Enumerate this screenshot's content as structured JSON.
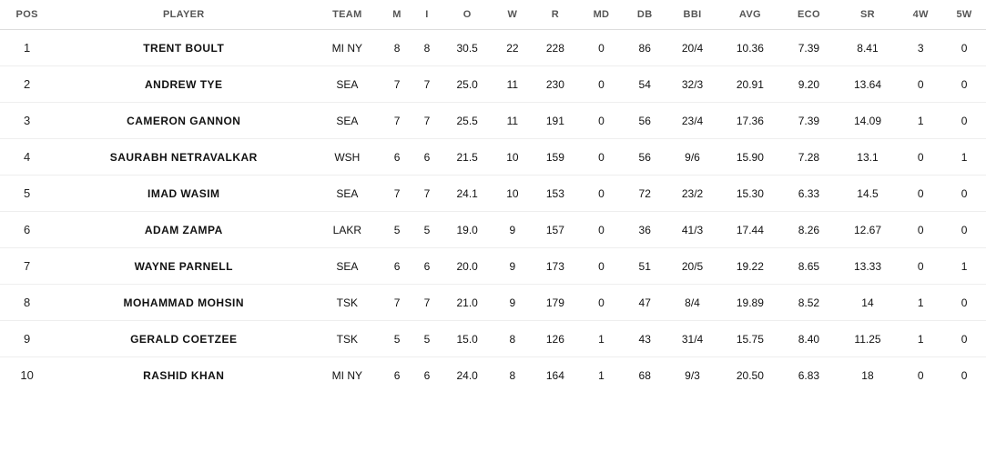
{
  "columns": [
    {
      "key": "pos",
      "label": "POS"
    },
    {
      "key": "player",
      "label": "PLAYER"
    },
    {
      "key": "team",
      "label": "TEAM"
    },
    {
      "key": "m",
      "label": "M"
    },
    {
      "key": "i",
      "label": "I"
    },
    {
      "key": "o",
      "label": "O"
    },
    {
      "key": "w",
      "label": "W"
    },
    {
      "key": "r",
      "label": "R"
    },
    {
      "key": "md",
      "label": "MD"
    },
    {
      "key": "db",
      "label": "DB"
    },
    {
      "key": "bbi",
      "label": "BBI"
    },
    {
      "key": "avg",
      "label": "AVG"
    },
    {
      "key": "eco",
      "label": "ECO"
    },
    {
      "key": "sr",
      "label": "SR"
    },
    {
      "key": "fw",
      "label": "4W"
    },
    {
      "key": "fivew",
      "label": "5W"
    }
  ],
  "rows": [
    {
      "pos": "1",
      "player": "TRENT BOULT",
      "team": "MI NY",
      "m": "8",
      "i": "8",
      "o": "30.5",
      "w": "22",
      "r": "228",
      "md": "0",
      "db": "86",
      "bbi": "20/4",
      "avg": "10.36",
      "eco": "7.39",
      "sr": "8.41",
      "fw": "3",
      "fivew": "0"
    },
    {
      "pos": "2",
      "player": "ANDREW TYE",
      "team": "SEA",
      "m": "7",
      "i": "7",
      "o": "25.0",
      "w": "11",
      "r": "230",
      "md": "0",
      "db": "54",
      "bbi": "32/3",
      "avg": "20.91",
      "eco": "9.20",
      "sr": "13.64",
      "fw": "0",
      "fivew": "0"
    },
    {
      "pos": "3",
      "player": "CAMERON GANNON",
      "team": "SEA",
      "m": "7",
      "i": "7",
      "o": "25.5",
      "w": "11",
      "r": "191",
      "md": "0",
      "db": "56",
      "bbi": "23/4",
      "avg": "17.36",
      "eco": "7.39",
      "sr": "14.09",
      "fw": "1",
      "fivew": "0"
    },
    {
      "pos": "4",
      "player": "SAURABH NETRAVALKAR",
      "team": "WSH",
      "m": "6",
      "i": "6",
      "o": "21.5",
      "w": "10",
      "r": "159",
      "md": "0",
      "db": "56",
      "bbi": "9/6",
      "avg": "15.90",
      "eco": "7.28",
      "sr": "13.1",
      "fw": "0",
      "fivew": "1"
    },
    {
      "pos": "5",
      "player": "IMAD WASIM",
      "team": "SEA",
      "m": "7",
      "i": "7",
      "o": "24.1",
      "w": "10",
      "r": "153",
      "md": "0",
      "db": "72",
      "bbi": "23/2",
      "avg": "15.30",
      "eco": "6.33",
      "sr": "14.5",
      "fw": "0",
      "fivew": "0"
    },
    {
      "pos": "6",
      "player": "ADAM ZAMPA",
      "team": "LAKR",
      "m": "5",
      "i": "5",
      "o": "19.0",
      "w": "9",
      "r": "157",
      "md": "0",
      "db": "36",
      "bbi": "41/3",
      "avg": "17.44",
      "eco": "8.26",
      "sr": "12.67",
      "fw": "0",
      "fivew": "0"
    },
    {
      "pos": "7",
      "player": "WAYNE PARNELL",
      "team": "SEA",
      "m": "6",
      "i": "6",
      "o": "20.0",
      "w": "9",
      "r": "173",
      "md": "0",
      "db": "51",
      "bbi": "20/5",
      "avg": "19.22",
      "eco": "8.65",
      "sr": "13.33",
      "fw": "0",
      "fivew": "1"
    },
    {
      "pos": "8",
      "player": "MOHAMMAD MOHSIN",
      "team": "TSK",
      "m": "7",
      "i": "7",
      "o": "21.0",
      "w": "9",
      "r": "179",
      "md": "0",
      "db": "47",
      "bbi": "8/4",
      "avg": "19.89",
      "eco": "8.52",
      "sr": "14",
      "fw": "1",
      "fivew": "0"
    },
    {
      "pos": "9",
      "player": "GERALD COETZEE",
      "team": "TSK",
      "m": "5",
      "i": "5",
      "o": "15.0",
      "w": "8",
      "r": "126",
      "md": "1",
      "db": "43",
      "bbi": "31/4",
      "avg": "15.75",
      "eco": "8.40",
      "sr": "11.25",
      "fw": "1",
      "fivew": "0"
    },
    {
      "pos": "10",
      "player": "RASHID KHAN",
      "team": "MI NY",
      "m": "6",
      "i": "6",
      "o": "24.0",
      "w": "8",
      "r": "164",
      "md": "1",
      "db": "68",
      "bbi": "9/3",
      "avg": "20.50",
      "eco": "6.83",
      "sr": "18",
      "fw": "0",
      "fivew": "0"
    }
  ]
}
